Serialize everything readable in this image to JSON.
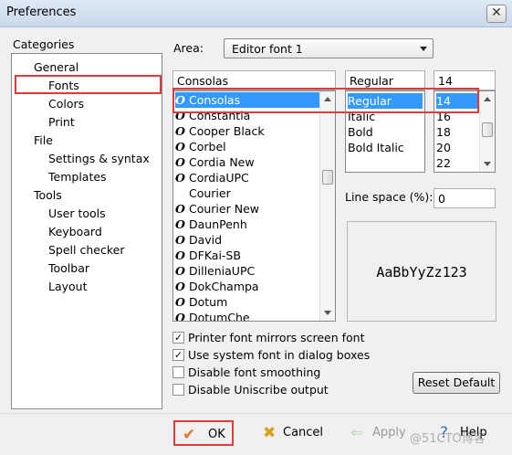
{
  "window": {
    "title": "Preferences",
    "close_glyph": "✕"
  },
  "categories": {
    "label": "Categories",
    "items": [
      {
        "label": "General",
        "level": 0
      },
      {
        "label": "Fonts",
        "level": 1
      },
      {
        "label": "Colors",
        "level": 1
      },
      {
        "label": "Print",
        "level": 1
      },
      {
        "label": "File",
        "level": 0
      },
      {
        "label": "Settings & syntax",
        "level": 1
      },
      {
        "label": "Templates",
        "level": 1
      },
      {
        "label": "Tools",
        "level": 0
      },
      {
        "label": "User tools",
        "level": 1
      },
      {
        "label": "Keyboard",
        "level": 1
      },
      {
        "label": "Spell checker",
        "level": 1
      },
      {
        "label": "Toolbar",
        "level": 1
      },
      {
        "label": "Layout",
        "level": 1
      }
    ],
    "selected": "Fonts"
  },
  "area": {
    "label": "Area:",
    "value": "Editor font 1"
  },
  "font": {
    "value": "Consolas",
    "list": [
      "Consolas",
      "Constantia",
      "Cooper Black",
      "Corbel",
      "Cordia New",
      "CordiaUPC",
      "Courier",
      "Courier New",
      "DaunPenh",
      "David",
      "DFKai-SB",
      "DilleniaUPC",
      "DokChampa",
      "Dotum",
      "DotumChe"
    ],
    "selected_index": 0,
    "icon_glyph": "O"
  },
  "style": {
    "value": "Regular",
    "list": [
      "Regular",
      "Italic",
      "Bold",
      "Bold Italic"
    ],
    "selected_index": 0
  },
  "size": {
    "value": "14",
    "list": [
      "14",
      "16",
      "18",
      "20",
      "22"
    ],
    "selected_index": 0
  },
  "line_space": {
    "label": "Line space (%):",
    "value": "0"
  },
  "preview_text": "AaBbYyZz123",
  "options": [
    {
      "label": "Printer font mirrors screen font",
      "checked": true
    },
    {
      "label": "Use system font in dialog boxes",
      "checked": true
    },
    {
      "label": "Disable font smoothing",
      "checked": false
    },
    {
      "label": "Disable Uniscribe output",
      "checked": false
    }
  ],
  "reset_label": "Reset Default",
  "footer": {
    "ok": "OK",
    "cancel": "Cancel",
    "apply": "Apply",
    "help": "Help"
  },
  "watermark": "@51CTO博客",
  "colors": {
    "highlight": "#e03a3a",
    "selection": "#3399ff"
  }
}
